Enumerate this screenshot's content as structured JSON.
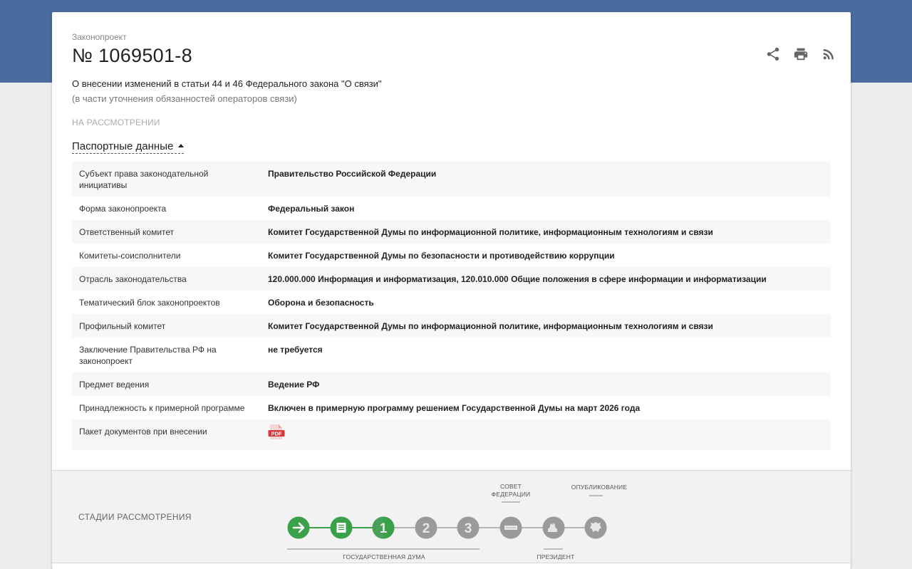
{
  "bill": {
    "type_label": "Законопроект",
    "number": "№ 1069501-8",
    "title": "О внесении изменений в статьи 44 и 46 Федерального закона \"О связи\"",
    "subtitle": "(в части уточнения обязанностей операторов связи)",
    "status": "НА РАССМОТРЕНИИ"
  },
  "passport": {
    "toggle_label": "Паспортные данные",
    "rows": [
      {
        "key": "Субъект права законодательной инициативы",
        "value": "Правительство Российской Федерации"
      },
      {
        "key": "Форма законопроекта",
        "value": "Федеральный закон"
      },
      {
        "key": "Ответственный комитет",
        "value": "Комитет Государственной Думы по информационной политике, информационным технологиям и связи"
      },
      {
        "key": "Комитеты-соисполнители",
        "value": "Комитет Государственной Думы по безопасности и противодействию коррупции"
      },
      {
        "key": "Отрасль законодательства",
        "value": "120.000.000 Информация и информатизация, 120.010.000 Общие положения в сфере информации и информатизации"
      },
      {
        "key": "Тематический блок законопроектов",
        "value": "Оборона и безопасность"
      },
      {
        "key": "Профильный комитет",
        "value": "Комитет Государственной Думы по информационной политике, информационным технологиям и связи"
      },
      {
        "key": "Заключение Правительства РФ на законопроект",
        "value": "не требуется"
      },
      {
        "key": "Предмет ведения",
        "value": "Ведение РФ"
      },
      {
        "key": "Принадлежность к примерной программе",
        "value": "Включен в примерную программу решением Государственной Думы на март 2026 года"
      },
      {
        "key": "Пакет документов при внесении",
        "value": ""
      }
    ],
    "pdf_icon_text": "PDF"
  },
  "toolbar": {
    "icons": [
      "share-icon",
      "print-icon",
      "rss-icon"
    ]
  },
  "stages": {
    "label": "СТАДИИ РАССМОТРЕНИЯ",
    "steps": [
      {
        "icon": "arrow-right-icon",
        "state": "completed"
      },
      {
        "icon": "document-icon",
        "state": "completed"
      },
      {
        "text": "1",
        "state": "current"
      },
      {
        "text": "2",
        "state": "pending"
      },
      {
        "text": "3",
        "state": "pending"
      },
      {
        "icon": "federation-council-icon",
        "state": "pending"
      },
      {
        "icon": "president-icon",
        "state": "pending"
      },
      {
        "icon": "emblem-icon",
        "state": "pending"
      }
    ],
    "labels": {
      "duma": "ГОСУДАРСТВЕННАЯ ДУМА",
      "council_line1": "СОВЕТ",
      "council_line2": "ФЕДЕРАЦИИ",
      "president": "ПРЕЗИДЕНТ",
      "publication": "ОПУБЛИКОВАНИЕ"
    },
    "colors": {
      "completed": "#3aa14a",
      "pending": "#9a9a9a",
      "line_done": "#3aa14a",
      "line_pending": "#b5b5b5"
    }
  }
}
